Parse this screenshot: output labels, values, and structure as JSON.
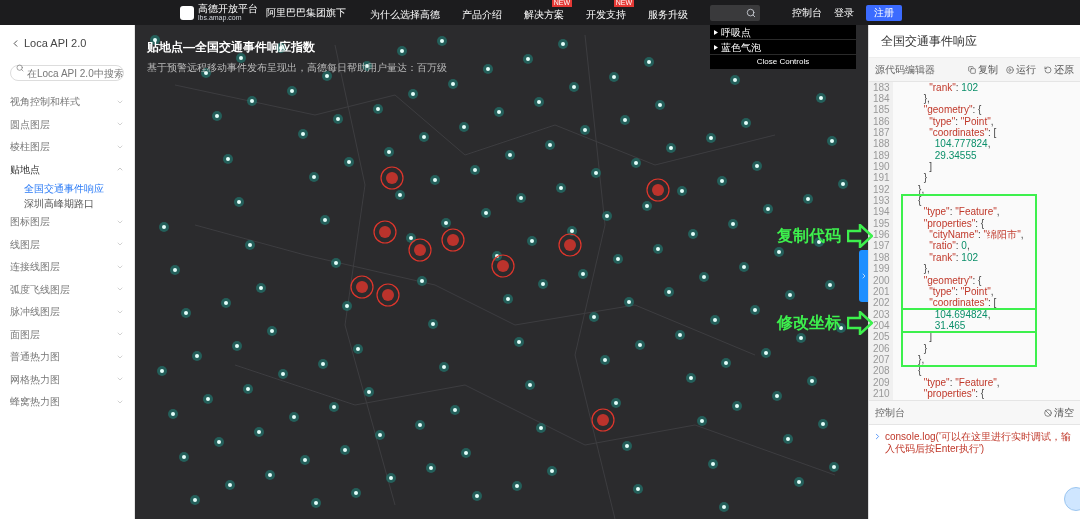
{
  "header": {
    "logo_title": "高德开放平台",
    "logo_subtitle": "lbs.amap.com",
    "tagline": "阿里巴巴集团旗下",
    "nav": [
      {
        "label": "为什么选择高德"
      },
      {
        "label": "产品介绍"
      },
      {
        "label": "解决方案",
        "badge": "NEW"
      },
      {
        "label": "开发支持",
        "badge": "NEW"
      },
      {
        "label": "服务升级"
      }
    ],
    "right_links": [
      "控制台",
      "登录"
    ],
    "register_button": "注册"
  },
  "sidebar": {
    "back_label": "Loca API 2.0",
    "search": {
      "placeholder": "在Loca API 2.0中搜索"
    },
    "items": [
      {
        "label": "视角控制和样式",
        "expanded": false
      },
      {
        "label": "圆点图层",
        "expanded": false
      },
      {
        "label": "棱柱图层",
        "expanded": false
      },
      {
        "label": "贴地点",
        "expanded": true,
        "children": [
          {
            "label": "全国交通事件响应",
            "selected": true
          },
          {
            "label": "深圳高峰期路口",
            "selected": false
          }
        ]
      },
      {
        "label": "图标图层",
        "expanded": false
      },
      {
        "label": "线图层",
        "expanded": false
      },
      {
        "label": "连接线图层",
        "expanded": false
      },
      {
        "label": "弧度飞线图层",
        "expanded": false
      },
      {
        "label": "脉冲线图层",
        "expanded": false
      },
      {
        "label": "面图层",
        "expanded": false
      },
      {
        "label": "普通热力图",
        "expanded": false
      },
      {
        "label": "网格热力图",
        "expanded": false
      },
      {
        "label": "蜂窝热力图",
        "expanded": false
      }
    ]
  },
  "map": {
    "title": "贴地点—全国交通事件响应指数",
    "subtitle": "基于预警远程移动事件发布呈现出，高德每日帮助用户量达：百万级",
    "controls": {
      "folders": [
        "呼吸点",
        "蓝色气泡"
      ],
      "close_label": "Close Controls"
    }
  },
  "panel": {
    "title": "全国交通事件响应",
    "editor_label": "源代码编辑器",
    "actions": [
      "复制",
      "运行",
      "还原"
    ],
    "code_lines": [
      {
        "number": "183",
        "code": "        \"rank\": 102"
      },
      {
        "number": "184",
        "code": "      },"
      },
      {
        "number": "185",
        "code": "      \"geometry\": {"
      },
      {
        "number": "186",
        "code": "        \"type\": \"Point\","
      },
      {
        "number": "187",
        "code": "        \"coordinates\": ["
      },
      {
        "number": "188",
        "code": "          104.777824,"
      },
      {
        "number": "189",
        "code": "          29.34555"
      },
      {
        "number": "190",
        "code": "        ]"
      },
      {
        "number": "191",
        "code": "      }"
      },
      {
        "number": "192",
        "code": "    },"
      },
      {
        "number": "193",
        "code": "    {"
      },
      {
        "number": "194",
        "code": "      \"type\": \"Feature\","
      },
      {
        "number": "195",
        "code": "      \"properties\": {"
      },
      {
        "number": "196",
        "code": "        \"cityName\": \"绵阳市\","
      },
      {
        "number": "197",
        "code": "        \"ratio\": 0,"
      },
      {
        "number": "198",
        "code": "        \"rank\": 102"
      },
      {
        "number": "199",
        "code": "      },"
      },
      {
        "number": "200",
        "code": "      \"geometry\": {"
      },
      {
        "number": "201",
        "code": "        \"type\": \"Point\","
      },
      {
        "number": "202",
        "code": "        \"coordinates\": ["
      },
      {
        "number": "203",
        "code": "          104.694824,"
      },
      {
        "number": "204",
        "code": "          31.465"
      },
      {
        "number": "205",
        "code": "        ]"
      },
      {
        "number": "206",
        "code": "      }"
      },
      {
        "number": "207",
        "code": "    },"
      },
      {
        "number": "208",
        "code": "    {"
      },
      {
        "number": "209",
        "code": "      \"type\": \"Feature\","
      },
      {
        "number": "210",
        "code": "      \"properties\": {"
      }
    ],
    "console_label": "控制台",
    "clear_label": "清空",
    "console_input": "console.log('可以在这里进行实时调试，输入代码后按Enter执行')"
  },
  "annotations": [
    {
      "label": "复制代码"
    },
    {
      "label": "修改坐标"
    }
  ]
}
